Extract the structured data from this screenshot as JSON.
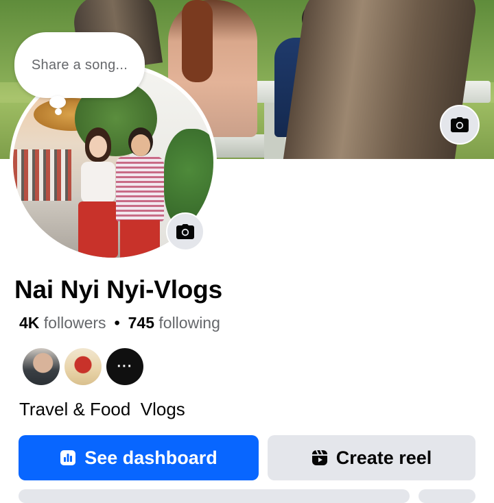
{
  "note": {
    "placeholder": "Share a song..."
  },
  "profile": {
    "name": "Nai Nyi Nyi-Vlogs",
    "followers_count": "4K",
    "followers_label": "followers",
    "separator": "•",
    "following_count": "745",
    "following_label": "following",
    "bio": "Travel & Food  Vlogs"
  },
  "friends": {
    "more_label": "···"
  },
  "actions": {
    "dashboard_label": "See dashboard",
    "create_reel_label": "Create reel"
  },
  "icons": {
    "cover_camera": "camera-icon",
    "avatar_camera": "camera-icon",
    "dashboard": "bar-chart-icon",
    "reel": "reel-icon"
  },
  "colors": {
    "primary": "#0866ff",
    "secondary_bg": "#e4e6eb",
    "text_primary": "#050505",
    "text_secondary": "#65676b"
  }
}
